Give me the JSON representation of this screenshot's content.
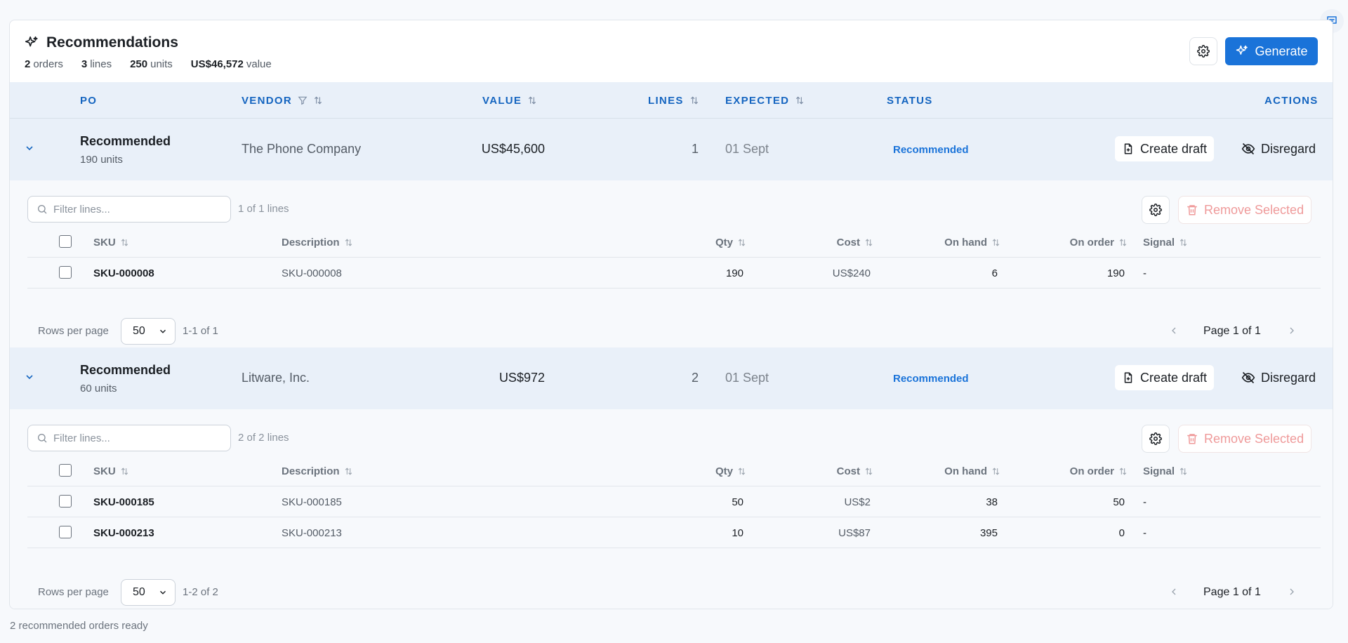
{
  "header": {
    "title": "Recommendations",
    "summary": {
      "orders_num": "2",
      "orders_label": "orders",
      "lines_num": "3",
      "lines_label": "lines",
      "units_num": "250",
      "units_label": "units",
      "value_num": "US$46,572",
      "value_label": "value"
    },
    "generate_label": "Generate"
  },
  "columns": {
    "po": "PO",
    "vendor": "VENDOR",
    "value": "VALUE",
    "lines": "LINES",
    "expected": "EXPECTED",
    "status": "STATUS",
    "actions": "ACTIONS"
  },
  "sub_columns": {
    "sku": "SKU",
    "description": "Description",
    "qty": "Qty",
    "cost": "Cost",
    "on_hand": "On hand",
    "on_order": "On order",
    "signal": "Signal"
  },
  "actions": {
    "create_draft": "Create draft",
    "disregard": "Disregard",
    "remove_selected": "Remove Selected"
  },
  "filter_placeholder": "Filter lines...",
  "rows_per_page_label": "Rows per page",
  "orders": [
    {
      "status": "Recommended",
      "units": "190 units",
      "vendor": "The Phone Company",
      "value": "US$45,600",
      "lines": "1",
      "expected": "01 Sept",
      "status_badge": "Recommended",
      "line_count": "1 of 1 lines",
      "rows_per_page": "50",
      "range": "1-1 of 1",
      "page": "Page 1 of 1",
      "items": [
        {
          "sku": "SKU-000008",
          "description": "SKU-000008",
          "qty": "190",
          "cost": "US$240",
          "on_hand": "6",
          "on_order": "190",
          "signal": "-"
        }
      ]
    },
    {
      "status": "Recommended",
      "units": "60 units",
      "vendor": "Litware, Inc.",
      "value": "US$972",
      "lines": "2",
      "expected": "01 Sept",
      "status_badge": "Recommended",
      "line_count": "2 of 2 lines",
      "rows_per_page": "50",
      "range": "1-2 of 2",
      "page": "Page 1 of 1",
      "items": [
        {
          "sku": "SKU-000185",
          "description": "SKU-000185",
          "qty": "50",
          "cost": "US$2",
          "on_hand": "38",
          "on_order": "50",
          "signal": "-"
        },
        {
          "sku": "SKU-000213",
          "description": "SKU-000213",
          "qty": "10",
          "cost": "US$87",
          "on_hand": "395",
          "on_order": "0",
          "signal": "-"
        }
      ]
    }
  ],
  "footer": "2 recommended orders ready",
  "colors": {
    "accent": "#1a73d9",
    "header_bg": "#e9f0f9",
    "danger_muted": "#ef9a9a"
  }
}
